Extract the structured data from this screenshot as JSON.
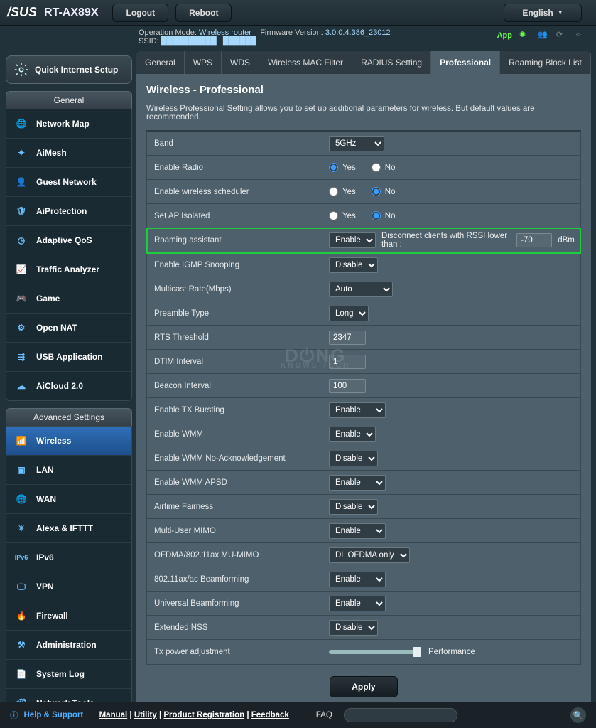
{
  "topbar": {
    "brand": "/SUS",
    "model": "RT-AX89X",
    "logout": "Logout",
    "reboot": "Reboot",
    "language": "English"
  },
  "info": {
    "op_mode_label": "Operation Mode:",
    "op_mode": "Wireless router",
    "fw_label": "Firmware Version:",
    "fw": "3.0.0.4.386_23012",
    "ssid_label": "SSID:",
    "ssid1": "██████████",
    "ssid2": "██████",
    "app": "App"
  },
  "sidebar": {
    "quick_setup": "Quick Internet Setup",
    "general_header": "General",
    "general": [
      {
        "label": "Network Map"
      },
      {
        "label": "AiMesh"
      },
      {
        "label": "Guest Network"
      },
      {
        "label": "AiProtection"
      },
      {
        "label": "Adaptive QoS"
      },
      {
        "label": "Traffic Analyzer"
      },
      {
        "label": "Game"
      },
      {
        "label": "Open NAT"
      },
      {
        "label": "USB Application"
      },
      {
        "label": "AiCloud 2.0"
      }
    ],
    "advanced_header": "Advanced Settings",
    "advanced": [
      {
        "label": "Wireless"
      },
      {
        "label": "LAN"
      },
      {
        "label": "WAN"
      },
      {
        "label": "Alexa & IFTTT"
      },
      {
        "label": "IPv6"
      },
      {
        "label": "VPN"
      },
      {
        "label": "Firewall"
      },
      {
        "label": "Administration"
      },
      {
        "label": "System Log"
      },
      {
        "label": "Network Tools"
      }
    ]
  },
  "tabs": [
    "General",
    "WPS",
    "WDS",
    "Wireless MAC Filter",
    "RADIUS Setting",
    "Professional",
    "Roaming Block List"
  ],
  "panel": {
    "title": "Wireless - Professional",
    "desc": "Wireless Professional Setting allows you to set up additional parameters for wireless. But default values are recommended."
  },
  "settings": {
    "band": {
      "label": "Band",
      "value": "5GHz"
    },
    "enable_radio": {
      "label": "Enable Radio",
      "yes": "Yes",
      "no": "No",
      "sel": "yes"
    },
    "wireless_sched": {
      "label": "Enable wireless scheduler",
      "yes": "Yes",
      "no": "No",
      "sel": "no"
    },
    "ap_isolated": {
      "label": "Set AP Isolated",
      "yes": "Yes",
      "no": "No",
      "sel": "no"
    },
    "roaming": {
      "label": "Roaming assistant",
      "value": "Enable",
      "text": "Disconnect clients with RSSI lower than :",
      "rssi": "-70",
      "unit": "dBm"
    },
    "igmp": {
      "label": "Enable IGMP Snooping",
      "value": "Disable"
    },
    "multicast": {
      "label": "Multicast Rate(Mbps)",
      "value": "Auto"
    },
    "preamble": {
      "label": "Preamble Type",
      "value": "Long"
    },
    "rts": {
      "label": "RTS Threshold",
      "value": "2347"
    },
    "dtim": {
      "label": "DTIM Interval",
      "value": "1"
    },
    "beacon": {
      "label": "Beacon Interval",
      "value": "100"
    },
    "txburst": {
      "label": "Enable TX Bursting",
      "value": "Enable"
    },
    "wmm": {
      "label": "Enable WMM",
      "value": "Enable"
    },
    "wmm_noack": {
      "label": "Enable WMM No-Acknowledgement",
      "value": "Disable"
    },
    "wmm_apsd": {
      "label": "Enable WMM APSD",
      "value": "Enable"
    },
    "airtime": {
      "label": "Airtime Fairness",
      "value": "Disable"
    },
    "mumimo": {
      "label": "Multi-User MIMO",
      "value": "Enable"
    },
    "ofdma": {
      "label": "OFDMA/802.11ax MU-MIMO",
      "value": "DL OFDMA only"
    },
    "beamform": {
      "label": "802.11ax/ac Beamforming",
      "value": "Enable"
    },
    "ubeamform": {
      "label": "Universal Beamforming",
      "value": "Enable"
    },
    "extnss": {
      "label": "Extended NSS",
      "value": "Disable"
    },
    "txpower": {
      "label": "Tx power adjustment",
      "value": "Performance"
    }
  },
  "apply": "Apply",
  "bottom": {
    "help": "Help & Support",
    "links": [
      "Manual",
      "Utility",
      "Product Registration",
      "Feedback"
    ],
    "faq": "FAQ"
  }
}
